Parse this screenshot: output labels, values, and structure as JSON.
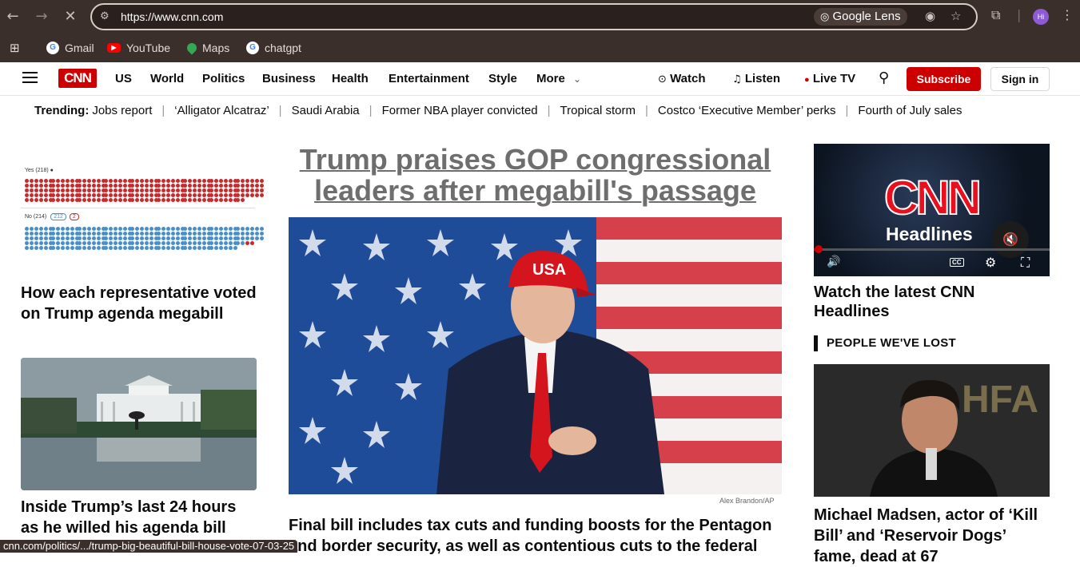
{
  "browser": {
    "url": "https://www.cnn.com",
    "lens_label": "Google Lens",
    "avatar_initials": "Hi",
    "bookmarks": [
      {
        "label": "Gmail",
        "icon": "google-icon"
      },
      {
        "label": "YouTube",
        "icon": "youtube-icon"
      },
      {
        "label": "Maps",
        "icon": "maps-icon"
      },
      {
        "label": "chatgpt",
        "icon": "google-icon"
      }
    ],
    "status_url": "cnn.com/politics/.../trump-big-beautiful-bill-house-vote-07-03-25"
  },
  "nav": {
    "logo": "CNN",
    "links": [
      "US",
      "World",
      "Politics",
      "Business",
      "Health",
      "Entertainment",
      "Style",
      "More"
    ],
    "watch": "Watch",
    "listen": "Listen",
    "live_tv": "Live TV",
    "subscribe": "Subscribe",
    "sign_in": "Sign in"
  },
  "trending": {
    "label": "Trending:",
    "items": [
      "Jobs report",
      "‘Alligator Alcatraz’",
      "Saudi Arabia",
      "Former NBA player convicted",
      "Tropical storm",
      "Costco ‘Executive Member’ perks",
      "Fourth of July sales"
    ]
  },
  "left": {
    "vote_yes_label": "Yes (218)",
    "vote_no_label": "No (214)",
    "vote_no_badge_a": "212",
    "vote_no_badge_b": "2",
    "story1": "How each representative voted on Trump agenda megabill",
    "story2": "Inside Trump’s last 24 hours as he willed his agenda bill"
  },
  "center": {
    "headline": "Trump praises GOP congressional leaders after megabill's passage",
    "credit": "Alex Brandon/AP",
    "summary": "Final bill includes tax cuts and funding boosts for the Pentagon and border security, as well as contentious cuts to the federal",
    "hat_text": "USA"
  },
  "right": {
    "video_brand": "CNN",
    "video_sub": "Headlines",
    "video_title": "Watch the latest CNN Headlines",
    "section": "PEOPLE WE'VE LOST",
    "madsen_title": "Michael Madsen, actor of ‘Kill Bill’ and ‘Reservoir Dogs’ fame, dead at 67",
    "backdrop_text": "HFA"
  },
  "colors": {
    "cnn_red": "#cc0000",
    "chrome_bg": "#3b2f2b",
    "yes_dot": "#c8292b",
    "no_dot": "#4a8ec9"
  }
}
